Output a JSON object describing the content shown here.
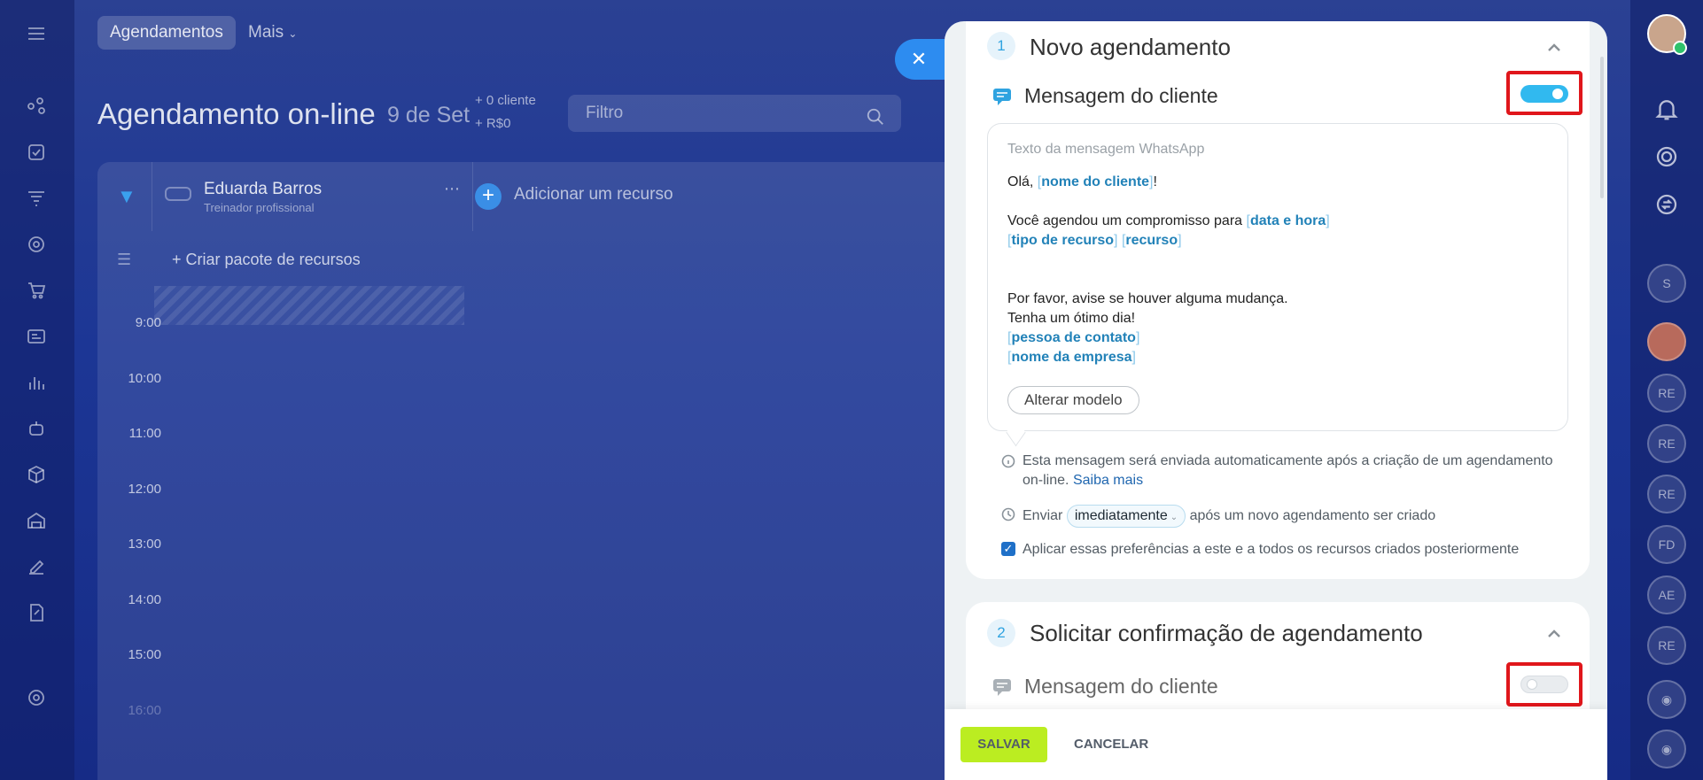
{
  "app": {
    "top_tab": "Agendamentos",
    "top_more": "Mais",
    "page_title": "Agendamento on-line",
    "page_date": "9 de Set",
    "stat_clients": "+ 0 cliente",
    "stat_revenue": "+ R$0",
    "filter_placeholder": "Filtro",
    "resource_name": "Eduarda Barros",
    "resource_role": "Treinador profissional",
    "add_resource": "Adicionar um recurso",
    "create_pack": "+ Criar pacote de recursos",
    "times": [
      "9:00",
      "10:00",
      "11:00",
      "12:00",
      "13:00",
      "14:00",
      "15:00",
      "16:00"
    ],
    "right_rail_avatars": [
      "S",
      "RE",
      "RE",
      "RE",
      "FD",
      "AE",
      "RE"
    ]
  },
  "panel": {
    "step1": {
      "number": "1",
      "title": "Novo agendamento",
      "message_label": "Mensagem do cliente",
      "toggle_on": true,
      "bubble_header": "Texto da mensagem WhatsApp",
      "greeting": "Olá, ",
      "tag_client": "nome do cliente",
      "greeting_end": "!",
      "line_scheduled": "Você agendou um compromisso para ",
      "tag_datetime": "data e hora",
      "tag_resource_type": "tipo de recurso",
      "tag_resource": "recurso",
      "line_notice": "Por favor, avise se houver alguma mudança.",
      "line_wish": "Tenha um ótimo dia!",
      "tag_contact": "pessoa de contato",
      "tag_company": "nome da empresa",
      "change_template": "Alterar modelo",
      "info_text": "Esta mensagem será enviada automaticamente após a criação de um agendamento on-line.",
      "info_link": "Saiba mais",
      "send_prefix": "Enviar",
      "send_value": "imediatamente",
      "send_suffix": "após um novo agendamento ser criado",
      "apply_label": "Aplicar essas preferências a este e a todos os recursos criados posteriormente",
      "apply_checked": true
    },
    "step2": {
      "number": "2",
      "title": "Solicitar confirmação de agendamento",
      "message_label": "Mensagem do cliente",
      "toggle_on": false
    },
    "footer": {
      "save": "SALVAR",
      "cancel": "CANCELAR"
    }
  },
  "colors": {
    "accent": "#31b9ef",
    "highlight_frame": "#e0161b",
    "save_button": "#bbed21",
    "tag_text": "#2282b8"
  }
}
